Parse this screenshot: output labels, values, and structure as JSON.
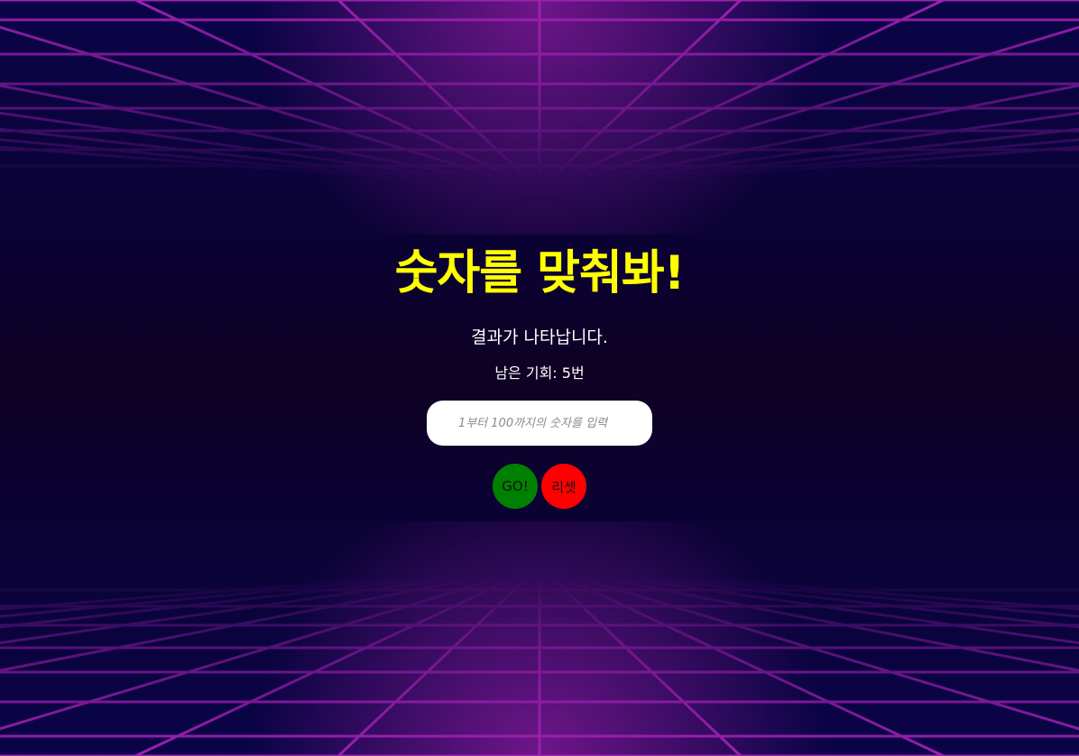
{
  "game": {
    "title": "숫자를 맞춰봐!",
    "result_text": "결과가 나타납니다.",
    "chances_text": "남은 기회: 5번",
    "input_placeholder": "1부터 100까지의 숫자를 입력",
    "input_value": "",
    "go_label": "GO!",
    "reset_label": "리셋"
  },
  "colors": {
    "title": "#ffff00",
    "go_button": "#008000",
    "reset_button": "#ff0000",
    "grid_lines": "#a020b0",
    "background": "#0b0232"
  }
}
